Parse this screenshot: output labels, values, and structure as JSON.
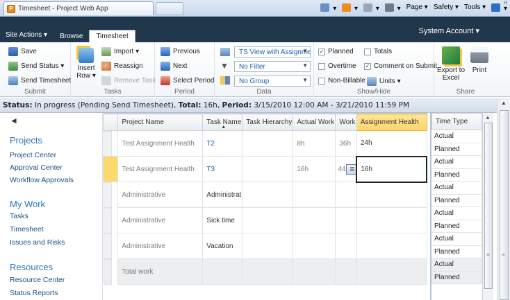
{
  "browser": {
    "tab_title": "Timesheet - Project Web App",
    "commands": [
      {
        "label": "",
        "icon": "home-icon",
        "color": "#6a8fc2"
      },
      {
        "label": "",
        "icon": "feeds-icon",
        "color": "#f28c1c"
      },
      {
        "label": "",
        "icon": "mail-icon",
        "color": "#9aa7b5"
      },
      {
        "label": "",
        "icon": "print-icon",
        "color": "#6b7b8c"
      },
      {
        "label": "Page",
        "icon": "",
        "color": ""
      },
      {
        "label": "Safety",
        "icon": "",
        "color": ""
      },
      {
        "label": "Tools",
        "icon": "",
        "color": ""
      },
      {
        "label": "",
        "icon": "help-icon",
        "color": "#2f6fc2"
      }
    ]
  },
  "ribbon": {
    "account": "System Account",
    "tabs": [
      {
        "label": "Site Actions"
      },
      {
        "label": "Browse"
      },
      {
        "label": "Timesheet"
      }
    ],
    "groups": {
      "submit": {
        "label": "Submit",
        "save": "Save",
        "send_status": "Send Status",
        "send_timesheet": "Send Timesheet"
      },
      "tasks": {
        "label": "Tasks",
        "insert_row_line1": "Insert",
        "insert_row_line2": "Row",
        "import": "Import",
        "reassign": "Reassign",
        "remove_task": "Remove Task"
      },
      "period": {
        "label": "Period",
        "previous": "Previous",
        "next": "Next",
        "select_period": "Select Period"
      },
      "data": {
        "label": "Data",
        "view": "TS View with Assignme",
        "filter": "No Filter",
        "group": "No Group"
      },
      "showhide": {
        "label": "Show/Hide",
        "planned": "Planned",
        "totals": "Totals",
        "overtime": "Overtime",
        "comment": "Comment on Submit",
        "nonbillable": "Non-Billable",
        "units": "Units"
      },
      "share": {
        "label": "Share",
        "export_line1": "Export to",
        "export_line2": "Excel",
        "print": "Print"
      }
    }
  },
  "status": {
    "k1": "Status:",
    "v1": "In progress (Pending Send Timesheet),",
    "k2": "Total:",
    "v2": "16h,",
    "k3": "Period:",
    "v3": "3/15/2010 12:00 AM - 3/21/2010 11:59 PM"
  },
  "nav": {
    "back": "◄",
    "sections": [
      {
        "header": "Projects",
        "items": [
          "Project Center",
          "Approval Center",
          "Workflow Approvals"
        ]
      },
      {
        "header": "My Work",
        "items": [
          "Tasks",
          "Timesheet",
          "Issues and Risks"
        ]
      },
      {
        "header": "Resources",
        "items": [
          "Resource Center",
          "Status Reports"
        ]
      }
    ]
  },
  "grid": {
    "columns": [
      "Project Name",
      "Task Name",
      "Task Hierarchy",
      "Actual Work",
      "Work",
      "Assignment Health"
    ],
    "rows": [
      {
        "project": "Test Assignment Health",
        "task": "T2",
        "hier": "",
        "actual": "8h",
        "work": "36h",
        "health": "24h"
      },
      {
        "project": "Test Assignment Health",
        "task": "T3",
        "hier": "",
        "actual": "16h",
        "work": "44",
        "health": "16h"
      },
      {
        "project": "Administrative",
        "task": "Administrat",
        "hier": "",
        "actual": "",
        "work": "",
        "health": ""
      },
      {
        "project": "Administrative",
        "task": "Sick time",
        "hier": "",
        "actual": "",
        "work": "",
        "health": ""
      },
      {
        "project": "Administrative",
        "task": "Vacation",
        "hier": "",
        "actual": "",
        "work": "",
        "health": ""
      },
      {
        "project": "Total work",
        "task": "",
        "hier": "",
        "actual": "",
        "work": "",
        "health": ""
      }
    ]
  },
  "timegrid": {
    "header": "Time Type",
    "rows": [
      "Actual",
      "Planned",
      "Actual",
      "Planned",
      "Actual",
      "Planned",
      "Actual",
      "Planned",
      "Actual",
      "Planned",
      "Actual",
      "Planned"
    ]
  },
  "colors": {
    "ribbon_dark": "#21374c",
    "highlight": "#fed56c",
    "link": "#1a5fab"
  }
}
